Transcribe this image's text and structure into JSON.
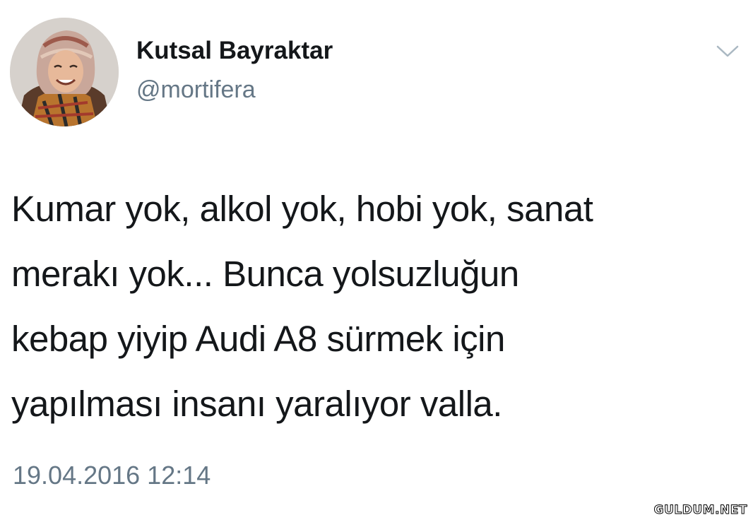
{
  "tweet": {
    "author": {
      "display_name": "Kutsal Bayraktar",
      "handle": "@mortifera",
      "avatar_icon": "profile-photo"
    },
    "menu_icon": "chevron-down-icon",
    "text_lines": [
      "Kumar yok, alkol yok, hobi yok, sanat",
      "merakı yok... Bunca yolsuzluğun",
      "kebap yiyip Audi A8 sürmek için",
      "yapılması insanı yaralıyor valla."
    ],
    "timestamp": "19.04.2016 12:14"
  },
  "watermark": "GULDUM.NET",
  "colors": {
    "text": "#14171a",
    "secondary": "#657786",
    "background": "#ffffff"
  }
}
